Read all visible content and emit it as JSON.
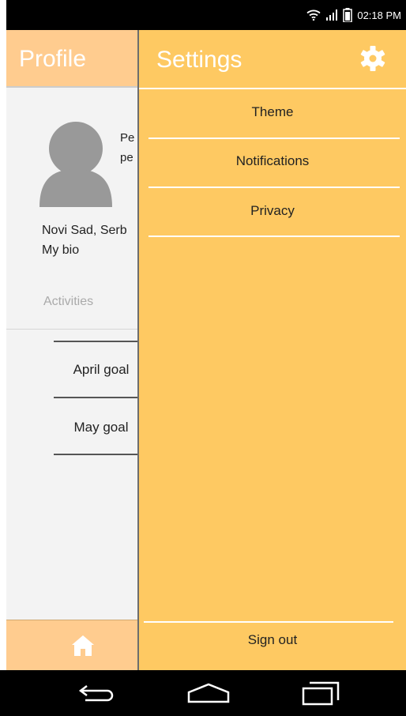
{
  "status_bar": {
    "time": "02:18 PM",
    "icons": [
      "wifi-icon",
      "signal-icon",
      "battery-icon"
    ]
  },
  "profile": {
    "title": "Profile",
    "name_line1": "Pe",
    "name_line2": "pe",
    "location": "Novi Sad, Serb",
    "bio": "My bio",
    "activities_label": "Activities",
    "activities": [
      {
        "label": "April goal"
      },
      {
        "label": "May goal"
      }
    ]
  },
  "drawer": {
    "title": "Settings",
    "items": [
      {
        "label": "Theme"
      },
      {
        "label": "Notifications"
      },
      {
        "label": "Privacy"
      }
    ],
    "sign_out": "Sign out"
  },
  "colors": {
    "drawer_bg": "#fec962",
    "header_bg": "#ffcc8f",
    "content_bg": "#f3f3f3"
  },
  "nav_bar": {
    "buttons": [
      "back-icon",
      "home-icon",
      "recent-apps-icon"
    ]
  }
}
